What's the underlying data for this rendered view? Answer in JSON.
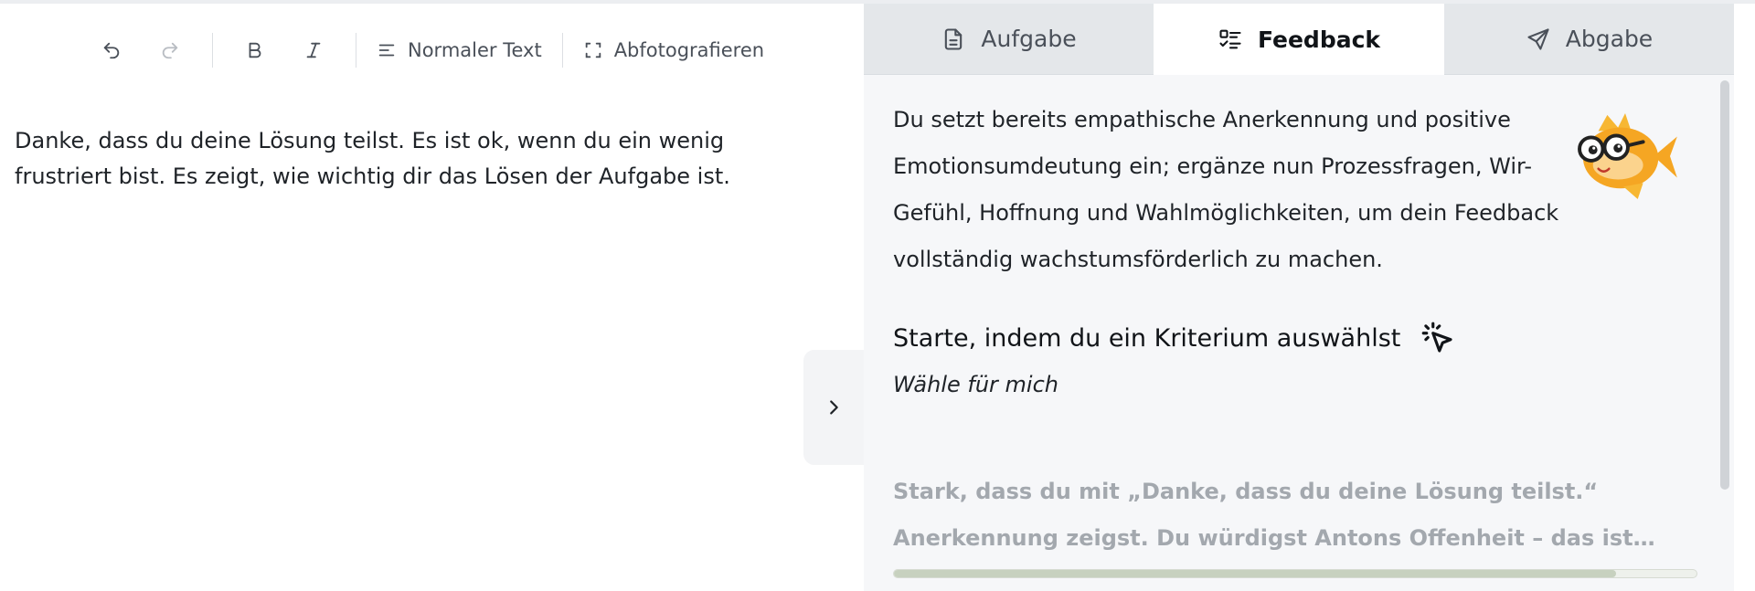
{
  "toolbar": {
    "undo_icon": "undo-icon",
    "redo_icon": "redo-icon",
    "bold_icon": "bold-icon",
    "italic_icon": "italic-icon",
    "text_style_label": "Normaler Text",
    "photo_label": "Abfotografieren"
  },
  "editor": {
    "text": "Danke, dass du deine Lösung teilst. Es ist ok, wenn du ein wenig frustriert bist. Es zeigt, wie wichtig dir das Lösen der Aufgabe ist."
  },
  "tabs": [
    {
      "label": "Aufgabe",
      "icon": "document-icon",
      "active": false
    },
    {
      "label": "Feedback",
      "icon": "checklist-icon",
      "active": true
    },
    {
      "label": "Abgabe",
      "icon": "send-icon",
      "active": false
    }
  ],
  "feedback": {
    "intro": "Du setzt bereits empathische Anerkennung und positive Emotionsumdeutung ein; ergänze nun Prozessfragen, Wir-Gefühl, Hoffnung und Wahlmöglichkeiten, um dein Feedback vollständig wachstumsförderlich zu machen.",
    "start_title": "Starte, indem du ein Kriterium auswählst",
    "choose_link": "Wähle für mich",
    "preview": "Stark, dass du mit „Danke, dass du deine Lösung teilst.“ Anerkennung zeigst. Du würdigst Antons Offenheit – das ist…",
    "progress_fraction": 0.9
  },
  "colors": {
    "accent_fish": "#f5a623",
    "panel_bg": "#f6f7f9",
    "tab_inactive": "#e4e7ea"
  }
}
